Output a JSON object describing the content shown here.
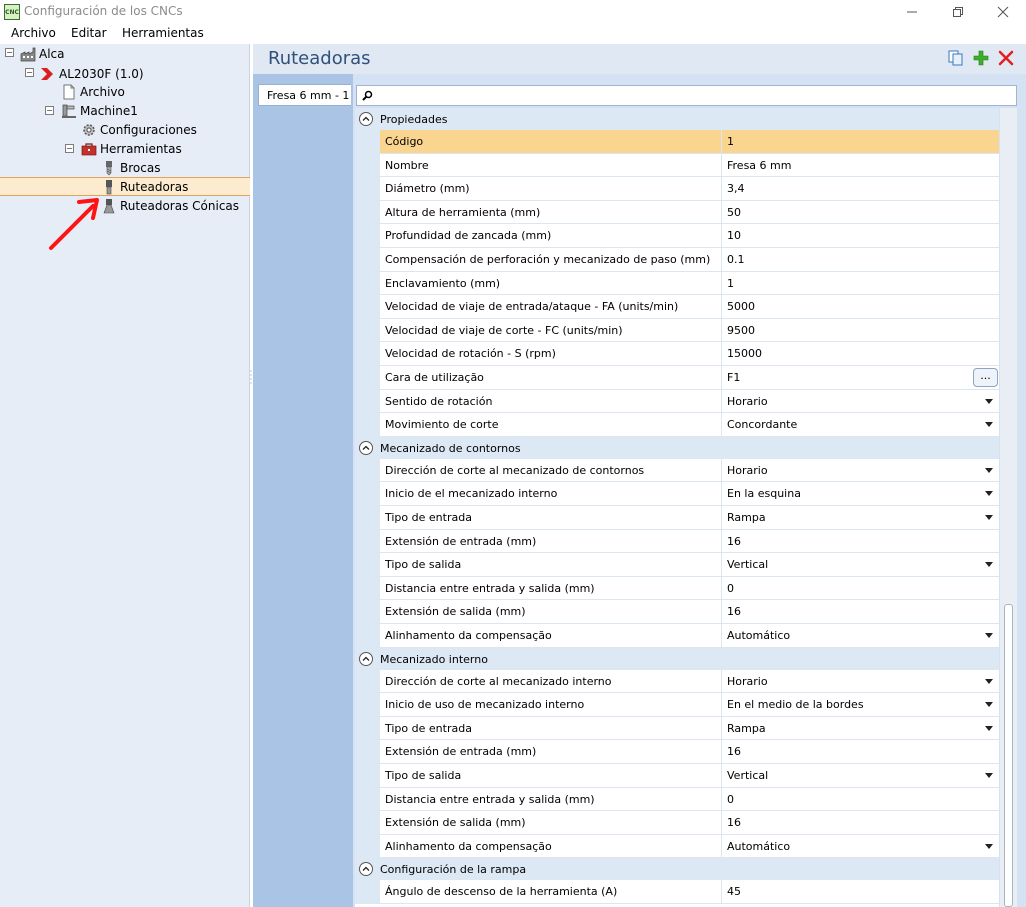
{
  "window": {
    "title": "Configuración de los CNCs",
    "app_icon_text": "CNC"
  },
  "menu": [
    "Archivo",
    "Editar",
    "Herramientas"
  ],
  "tree": {
    "root": "Alca",
    "machine_group": "AL2030F (1.0)",
    "archivo": "Archivo",
    "machine": "Machine1",
    "configuraciones": "Configuraciones",
    "herramientas": "Herramientas",
    "brocas": "Brocas",
    "ruteadoras": "Ruteadoras",
    "ruteadoras_conicas": "Ruteadoras Cónicas"
  },
  "header": {
    "title": "Ruteadoras"
  },
  "tab": {
    "label": "Fresa 6 mm - 1"
  },
  "search": {
    "value": "",
    "placeholder": ""
  },
  "sections": {
    "propiedades": "Propiedades",
    "contornos": "Mecanizado de contornos",
    "interno": "Mecanizado interno",
    "rampa": "Configuración de la rampa"
  },
  "rows": {
    "codigo": {
      "name": "Código",
      "value": "1"
    },
    "nombre": {
      "name": "Nombre",
      "value": "Fresa 6 mm"
    },
    "diametro": {
      "name": "Diámetro (mm)",
      "value": "3,4"
    },
    "altura": {
      "name": "Altura de herramienta (mm)",
      "value": "50"
    },
    "profundidad": {
      "name": "Profundidad de zancada (mm)",
      "value": "10"
    },
    "compensacion": {
      "name": "Compensación de perforación y mecanizado de paso (mm)",
      "value": "0.1"
    },
    "enclavamiento": {
      "name": "Enclavamiento (mm)",
      "value": "1"
    },
    "vel_entrada": {
      "name": "Velocidad de viaje de entrada/ataque - FA (units/min)",
      "value": "5000"
    },
    "vel_corte": {
      "name": "Velocidad de viaje de corte - FC (units/min)",
      "value": "9500"
    },
    "vel_rotacion": {
      "name": "Velocidad de rotación - S (rpm)",
      "value": "15000"
    },
    "cara": {
      "name": "Cara de utilização",
      "value": "F1",
      "button": "..."
    },
    "sentido": {
      "name": "Sentido de rotación",
      "value": "Horario"
    },
    "movimiento": {
      "name": "Movimiento de corte",
      "value": "Concordante"
    },
    "c_direccion": {
      "name": "Dirección de corte al mecanizado de contornos",
      "value": "Horario"
    },
    "c_inicio": {
      "name": "Inicio de el mecanizado interno",
      "value": "En la esquina"
    },
    "c_tipo_entrada": {
      "name": "Tipo de entrada",
      "value": "Rampa"
    },
    "c_ext_entrada": {
      "name": "Extensión de entrada (mm)",
      "value": "16"
    },
    "c_tipo_salida": {
      "name": "Tipo de salida",
      "value": "Vertical"
    },
    "c_distancia": {
      "name": "Distancia entre entrada y salida (mm)",
      "value": "0"
    },
    "c_ext_salida": {
      "name": "Extensión de salida (mm)",
      "value": "16"
    },
    "c_alineamiento": {
      "name": "Alinhamento da compensação",
      "value": "Automático"
    },
    "i_direccion": {
      "name": "Dirección de corte al mecanizado interno",
      "value": "Horario"
    },
    "i_inicio": {
      "name": "Inicio de uso de mecanizado interno",
      "value": "En el medio de la bordes"
    },
    "i_tipo_entrada": {
      "name": "Tipo de entrada",
      "value": "Rampa"
    },
    "i_ext_entrada": {
      "name": "Extensión de entrada (mm)",
      "value": "16"
    },
    "i_tipo_salida": {
      "name": "Tipo de salida",
      "value": "Vertical"
    },
    "i_distancia": {
      "name": "Distancia entre entrada y salida (mm)",
      "value": "0"
    },
    "i_ext_salida": {
      "name": "Extensión de salida (mm)",
      "value": "16"
    },
    "i_alineamiento": {
      "name": "Alinhamento da compensação",
      "value": "Automático"
    },
    "r_angulo": {
      "name": "Ángulo de descenso de la herramienta (A)",
      "value": "45"
    }
  },
  "colors": {
    "selected_row": "#fad58f",
    "tree_selection": "#fdebd0",
    "section_header": "#dde8f5",
    "tab_strip": "#a9c4e4",
    "delete_icon": "#e02020",
    "add_icon": "#3fae2a"
  }
}
